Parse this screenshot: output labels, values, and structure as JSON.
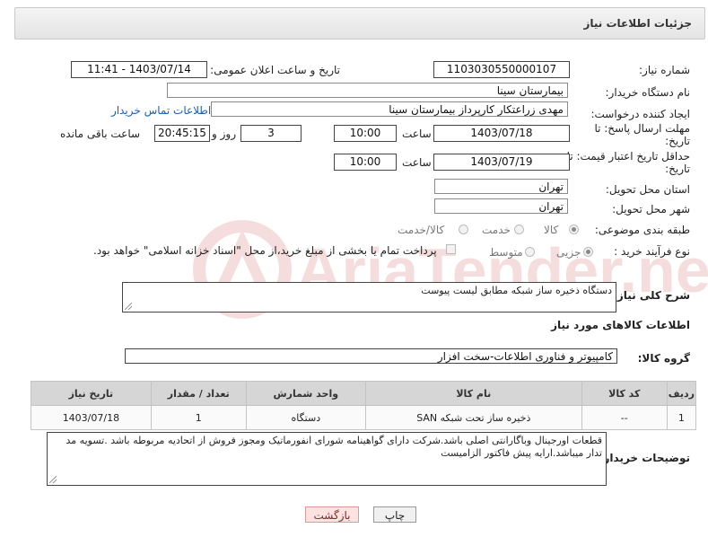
{
  "header": {
    "title": "جزئیات اطلاعات نیاز"
  },
  "labels": {
    "need_number": "شماره نیاز:",
    "announce_datetime": "تاریخ و ساعت اعلان عمومی:",
    "buyer_org": "نام دستگاه خریدار:",
    "requester": "ایجاد کننده درخواست:",
    "reply_deadline_line1": "مهلت ارسال پاسخ: تا",
    "reply_deadline_line2": "تاریخ:",
    "price_validity_line1": "حداقل تاریخ اعتبار قیمت: تا",
    "price_validity_line2": "تاریخ:",
    "hour": "ساعت",
    "hour2": "ساعت",
    "day_and": "روز و",
    "hours_remaining": "ساعت باقی مانده",
    "delivery_province": "استان محل تحویل:",
    "delivery_city": "شهر محل تحویل:",
    "subject_category": "طبقه بندی موضوعی:",
    "purchase_process": "نوع فرآیند خرید :",
    "general_description": "شرح کلی نیاز:",
    "goods_info": "اطلاعات کالاهای مورد نیاز",
    "goods_group": "گروه کالا:",
    "buyer_notes": "توضیحات خریدار:"
  },
  "fields": {
    "need_number": "1103030550000107",
    "announce_datetime": "1403/07/14 - 11:41",
    "buyer_org": "بیمارستان سینا",
    "requester": "مهدی  زراعتکار  کارپرداز بیمارستان سینا",
    "contact_link": "اطلاعات تماس خریدار",
    "reply_date": "1403/07/18",
    "reply_time": "10:00",
    "days_left": "3",
    "time_left": "20:45:15",
    "validity_date": "1403/07/19",
    "validity_time": "10:00",
    "province": "تهران",
    "city": "تهران",
    "general_description": "دستگاه ذخیره ساز شبکه مطابق لیست پیوست",
    "goods_group": "کامپیوتر و فناوری اطلاعات-سخت افزار",
    "buyer_notes": "قطعات اورجینال وباگارانتی اصلی باشد.شرکت دارای گواهینامه شورای انفورماتیک ومجوز  فروش از اتحادیه مربوطه باشد .تسویه مد تدار میباشد.ارایه پیش فاکتور الزامیست"
  },
  "subject_options": [
    {
      "label": "کالا",
      "selected": true
    },
    {
      "label": "خدمت",
      "selected": false
    },
    {
      "label": "کالا/خدمت",
      "selected": false
    }
  ],
  "process_options": [
    {
      "label": "جزیی",
      "selected": true
    },
    {
      "label": "متوسط",
      "selected": false
    }
  ],
  "payment_note": "پرداخت تمام یا بخشی از مبلغ خرید،از محل \"اسناد خزانه اسلامی\" خواهد بود.",
  "table": {
    "headers": [
      "ردیف",
      "کد کالا",
      "نام کالا",
      "واحد شمارش",
      "تعداد / مقدار",
      "تاریخ نیاز"
    ],
    "rows": [
      [
        "1",
        "--",
        "ذخیره ساز تحت شبکه SAN",
        "دستگاه",
        "1",
        "1403/07/18"
      ]
    ]
  },
  "buttons": {
    "print": "چاپ",
    "back": "بازگشت"
  },
  "watermark": "AriaTender.neT"
}
